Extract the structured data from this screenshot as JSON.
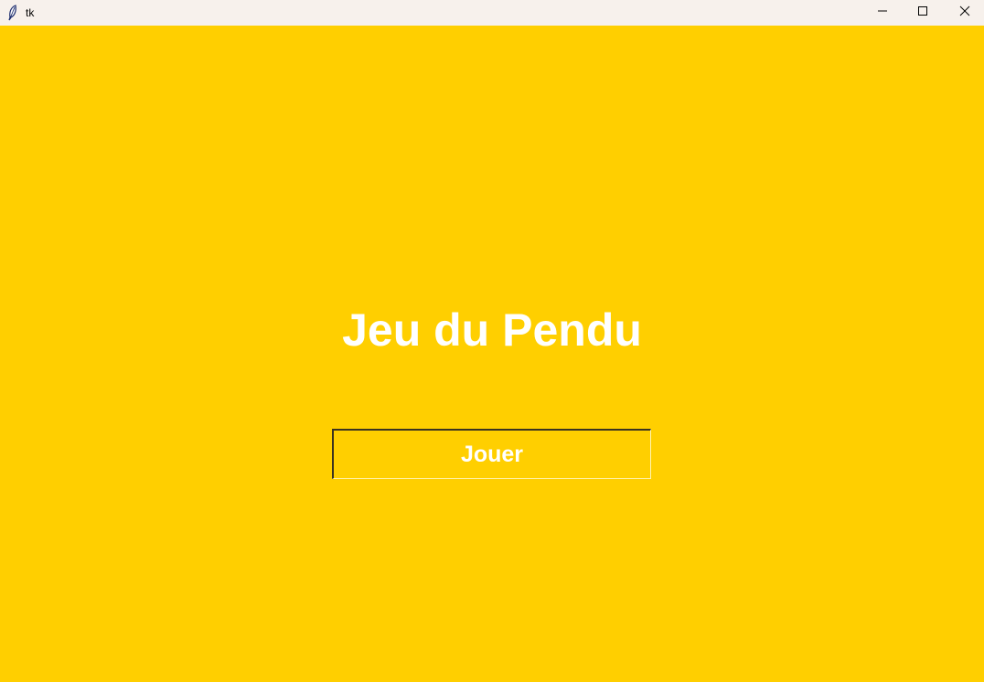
{
  "window": {
    "title": "tk",
    "icon": "tk-feather-icon",
    "controls": {
      "minimize_icon": "minimize-icon",
      "maximize_icon": "maximize-icon",
      "close_icon": "close-icon"
    }
  },
  "main": {
    "title": "Jeu du Pendu",
    "play_label": "Jouer"
  },
  "colors": {
    "background": "#ffcf00",
    "text": "#ffffff",
    "titlebar": "#f7f1ec"
  }
}
